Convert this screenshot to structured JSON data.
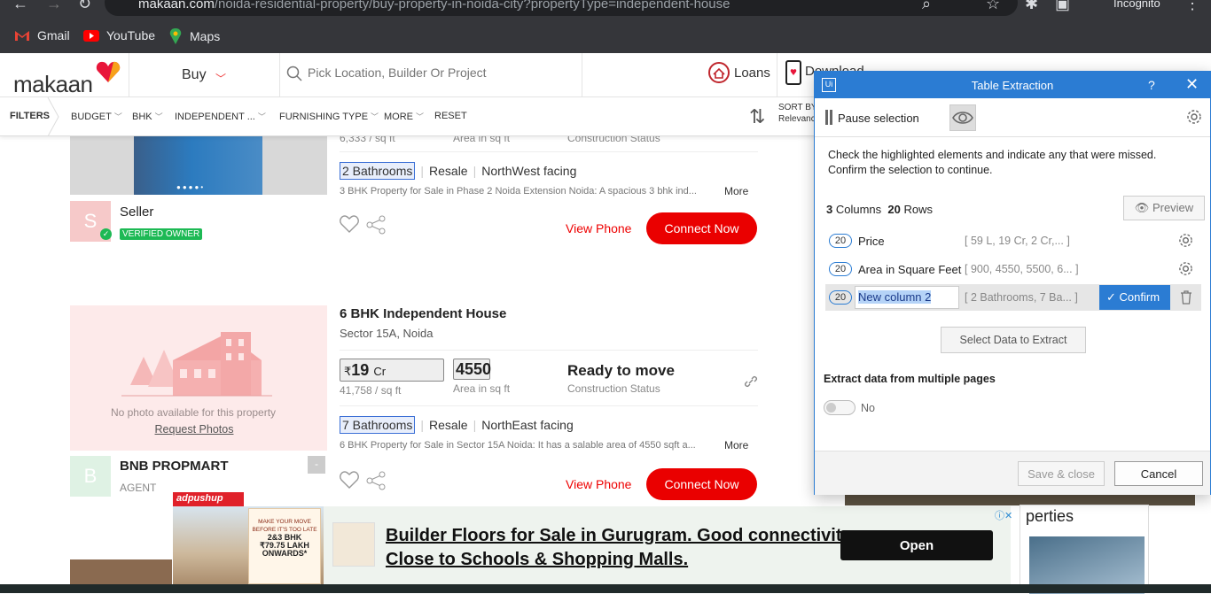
{
  "browser": {
    "url_host": "makaan.com",
    "url_path": "/noida-residential-property/buy-property-in-noida-city?propertyType=independent-house",
    "profile_label": "Incognito",
    "bookmarks": [
      "Gmail",
      "YouTube",
      "Maps"
    ]
  },
  "header": {
    "logo_text": "makaan",
    "mode": "Buy",
    "search_placeholder": "Pick Location, Builder Or Project",
    "loans_label": "Loans",
    "download_label": "Download"
  },
  "filters": {
    "label": "FILTERS",
    "items": [
      "BUDGET",
      "BHK",
      "INDEPENDENT ...",
      "FURNISHING TYPE",
      "MORE",
      "RESET"
    ],
    "sort_label": "SORT BY",
    "sort_value": "Relevance"
  },
  "listing1": {
    "price_per_sqft": "6,333 / sq ft",
    "area_caption": "Area in sq ft",
    "status_caption": "Construction Status",
    "bathrooms": "2 Bathrooms",
    "sale_type": "Resale",
    "facing": "NorthWest facing",
    "description": "3 BHK Property for Sale in Phase 2 Noida Extension Noida: A spacious 3 bhk ind...",
    "more": "More",
    "seller_initial": "S",
    "seller_name": "Seller",
    "seller_badge": "VERIFIED OWNER",
    "view_phone": "View Phone",
    "connect": "Connect Now"
  },
  "listing2": {
    "title": "6 BHK Independent House",
    "location": "Sector 15A, Noida",
    "price_symbol": "₹",
    "price": "19",
    "price_unit": "Cr",
    "price_per_sqft": "41,758 / sq ft",
    "area": "4550",
    "area_caption": "Area in sq ft",
    "status": "Ready to move",
    "status_caption": "Construction Status",
    "bathrooms": "7 Bathrooms",
    "sale_type": "Resale",
    "facing": "NorthEast facing",
    "description": "6 BHK Property for Sale in Sector 15A Noida: It has a salable area of 4550 sqft a...",
    "more": "More",
    "no_photo": "No photo available for this property",
    "request_photos": "Request Photos",
    "seller_initial": "B",
    "seller_name": "BNB PROPMART",
    "seller_type": "AGENT",
    "view_phone": "View Phone",
    "connect": "Connect Now"
  },
  "dialog": {
    "title": "Table Extraction",
    "help": "?",
    "pause_label": "Pause selection",
    "instructions_line1": "Check the highlighted elements and indicate any that were missed.",
    "instructions_line2": "Confirm the selection to continue.",
    "columns_count": "3",
    "columns_word": "Columns",
    "rows_count": "20",
    "rows_word": "Rows",
    "preview_label": "Preview",
    "columns": [
      {
        "count": "20",
        "name": "Price",
        "sample": "[ 59 L,  19 Cr,  2 Cr,... ]"
      },
      {
        "count": "20",
        "name": "Area in Square Feet",
        "sample": "[ 900, 4550, 5500, 6... ]"
      },
      {
        "count": "20",
        "name": "New column 2",
        "sample": "[ 2 Bathrooms, 7 Ba... ]"
      }
    ],
    "confirm_label": "Confirm",
    "select_data_label": "Select Data to Extract",
    "multi_page_label": "Extract data from multiple pages",
    "toggle_label": "No",
    "save_label": "Save & close",
    "cancel_label": "Cancel"
  },
  "ad": {
    "tag": "adpushup",
    "poster_line1": "MAKE YOUR MOVE",
    "poster_line2": "BEFORE IT'S TOO LATE",
    "poster_line3": "2&3 BHK",
    "poster_line4": "₹79.75 LAKH",
    "poster_line5": "ONWARDS*",
    "headline": "Builder Floors for Sale in Gurugram. Good connectivity. Close to Schools & Shopping Malls.",
    "open_label": "Open"
  },
  "sidebar": {
    "properties_fragment": "perties"
  },
  "colors": {
    "brand_red": "#ea0000",
    "dialog_blue": "#2b7cd3",
    "verified_green": "#1db954"
  }
}
